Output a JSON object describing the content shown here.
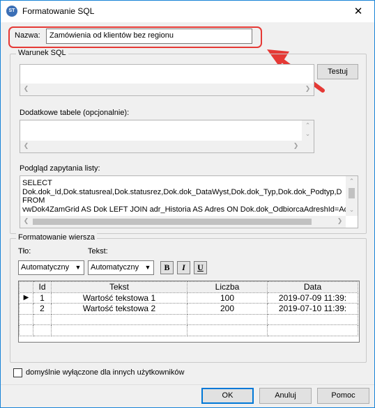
{
  "window": {
    "title": "Formatowanie SQL",
    "app_icon_text": "ST",
    "close_glyph": "✕"
  },
  "name": {
    "label": "Nazwa:",
    "value": "Zamówienia od klientów bez regionu"
  },
  "sql_condition": {
    "group_title": "Warunek SQL",
    "test_button": "Testuj",
    "extra_tables_label": "Dodatkowe tabele (opcjonalnie):",
    "preview_label": "Podgląd zapytania listy:",
    "preview_lines": [
      "SELECT",
      "Dok.dok_Id,Dok.statusreal,Dok.statusrez,Dok.dok_DataWyst,Dok.dok_Typ,Dok.dok_Podtyp,D",
      "FROM",
      "vwDok4ZamGrid AS Dok LEFT JOIN adr_Historia AS Adres ON Dok.dok_OdbiorcaAdreshId=Adre"
    ]
  },
  "row_format": {
    "group_title": "Formatowanie wiersza",
    "background_label": "Tło:",
    "text_label": "Tekst:",
    "background_value": "Automatyczny",
    "text_value": "Automatyczny",
    "bold_label": "B",
    "italic_label": "I",
    "underline_label": "U",
    "columns": [
      "Id",
      "Tekst",
      "Liczba",
      "Data"
    ],
    "rows": [
      {
        "indicator": "▶",
        "id": "1",
        "tekst": "Wartość tekstowa 1",
        "liczba": "100",
        "data": "2019-07-09 11:39:"
      },
      {
        "indicator": "",
        "id": "2",
        "tekst": "Wartość tekstowa 2",
        "liczba": "200",
        "data": "2019-07-10 11:39:"
      }
    ]
  },
  "checkbox": {
    "label": "domyślnie wyłączone dla innych użytkowników",
    "checked": false
  },
  "buttons": {
    "ok": "OK",
    "cancel": "Anuluj",
    "help": "Pomoc"
  },
  "colors": {
    "highlight": "#e53935",
    "accent": "#0078d7"
  }
}
